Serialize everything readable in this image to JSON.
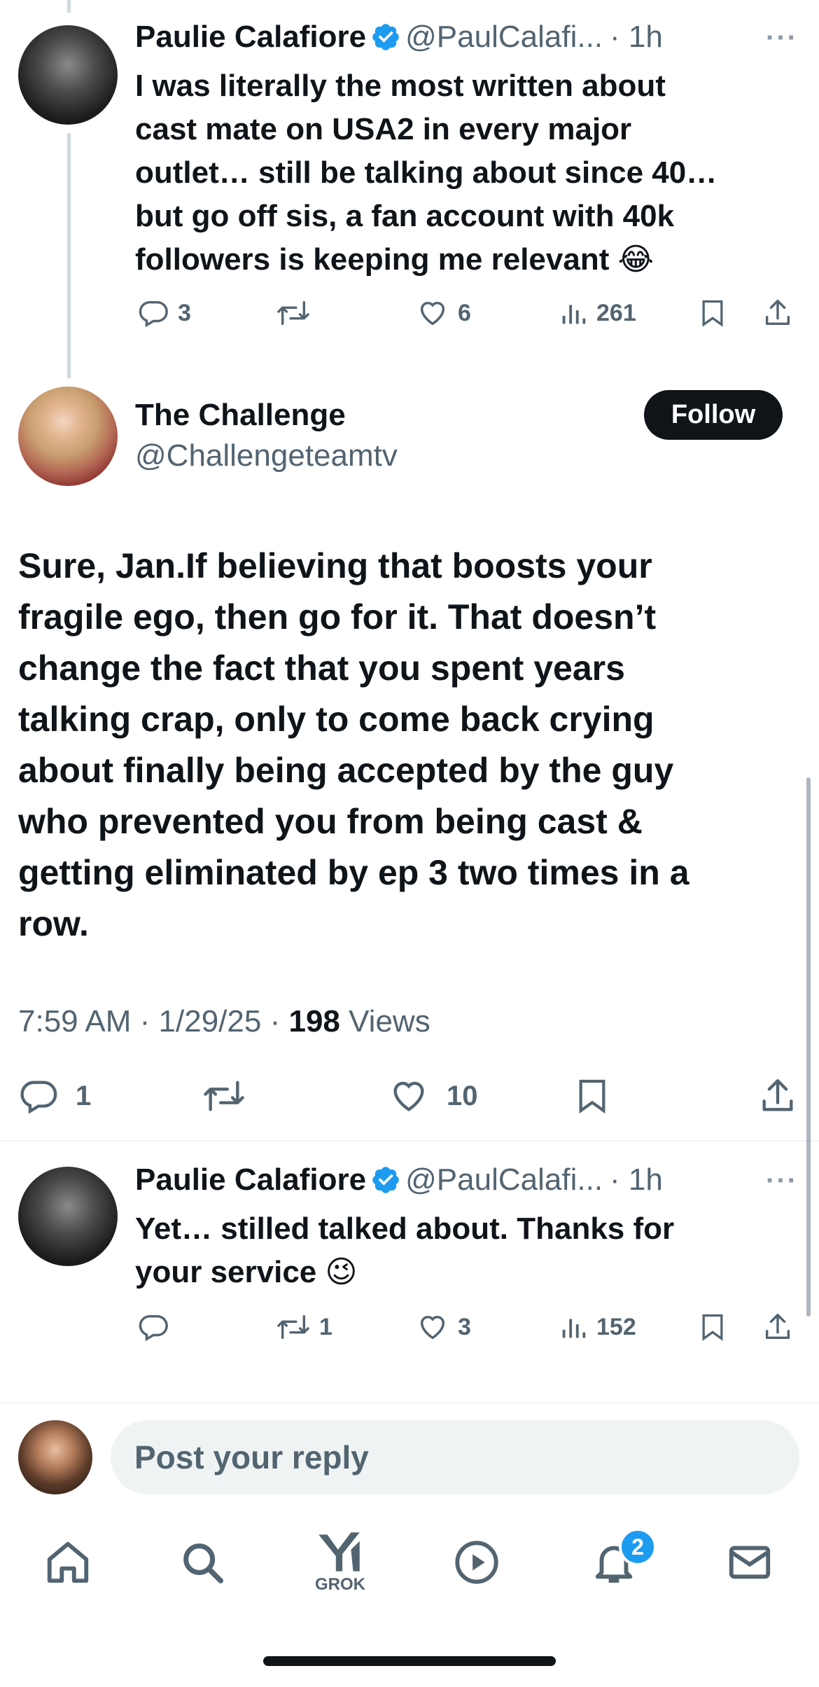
{
  "colors": {
    "accent": "#1d9bf0",
    "text": "#0f1419",
    "muted": "#536471"
  },
  "tweet1": {
    "name": "Paulie Calafiore",
    "handle": "@PaulCalafi...",
    "time": "· 1h",
    "more": "···",
    "lines": [
      "I was literally the most written about",
      "cast mate on USA2 in every major",
      "outlet… still be talking about since 40…",
      "but go off sis, a fan account with 40k",
      "followers is keeping me relevant 😂"
    ],
    "replies": "3",
    "retweets": "",
    "likes": "6",
    "views": "261"
  },
  "main": {
    "name": "The Challenge",
    "handle": "@Challengeteamtv",
    "follow_label": "Follow",
    "lines": [
      "Sure, Jan.If believing that boosts your",
      "fragile ego, then go for it. That doesn’t",
      "change the fact that you spent years",
      "talking crap, only to come back crying",
      "about finally being accepted by the guy",
      "who prevented you from being cast &",
      "getting eliminated by ep 3 two times in a",
      "row."
    ],
    "time": "7:59 AM",
    "date": "1/29/25",
    "views_count": "198",
    "views_label": "Views",
    "replies": "1",
    "retweets": "",
    "likes": "10"
  },
  "tweet2": {
    "name": "Paulie Calafiore",
    "handle": "@PaulCalafi...",
    "time": "· 1h",
    "more": "···",
    "lines": [
      "Yet… stilled talked about. Thanks for",
      "your service 😉"
    ],
    "replies": "",
    "retweets": "1",
    "likes": "3",
    "views": "152"
  },
  "reply": {
    "placeholder": "Post your reply"
  },
  "nav": {
    "items": [
      "home-icon",
      "search-icon",
      "grok-icon",
      "video-icon",
      "notifications-icon",
      "messages-icon"
    ],
    "grok_label": "GROK",
    "notifications_badge": "2"
  }
}
